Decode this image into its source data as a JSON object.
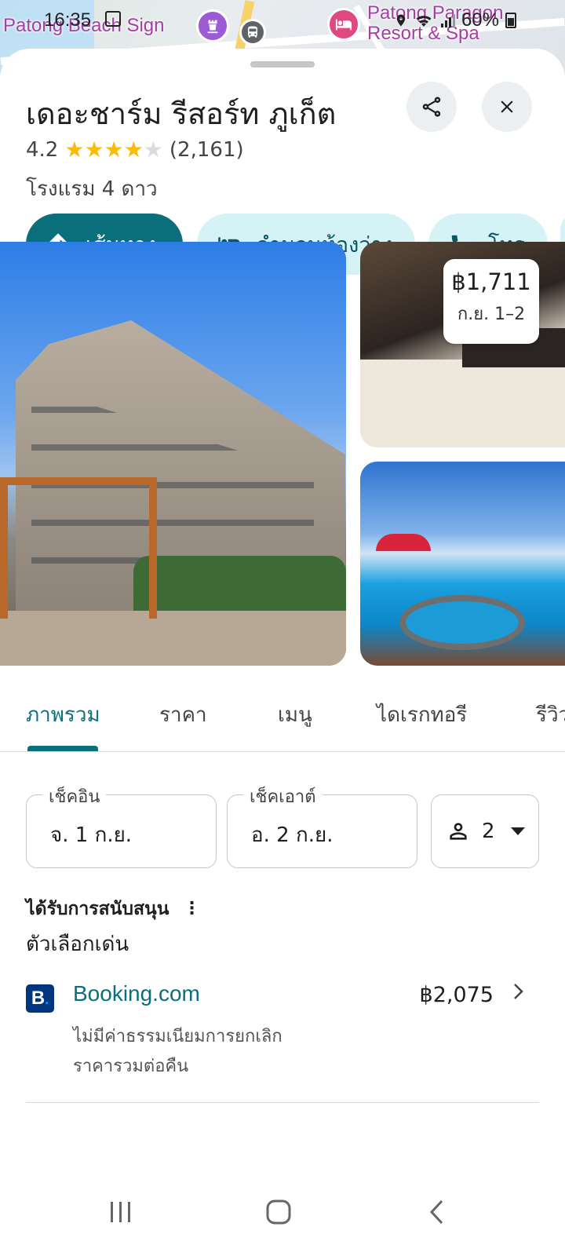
{
  "status_bar": {
    "time": "16:35",
    "battery": "60%"
  },
  "map": {
    "labels": [
      "Patong Beach Sign",
      "Patong Paragon Resort & Spa"
    ]
  },
  "place": {
    "title": "เดอะชาร์ม รีสอร์ท ภูเก็ต",
    "rating": "4.2",
    "rating_stars": 4.2,
    "reviews": "(2,161)",
    "category": "โรงแรม 4 ดาว"
  },
  "actions": {
    "directions": "เส้นทาง",
    "rooms": "จำนวนห้องว่าง",
    "call": "โทร"
  },
  "photo_price": {
    "price": "฿1,711",
    "dates": "ก.ย. 1–2"
  },
  "tabs": [
    "ภาพรวม",
    "ราคา",
    "เมนู",
    "ไดเรกทอรี",
    "รีวิว"
  ],
  "booking": {
    "checkin_label": "เช็คอิน",
    "checkin_value": "จ. 1 ก.ย.",
    "checkout_label": "เช็คเอาต์",
    "checkout_value": "อ. 2 ก.ย.",
    "guests": "2"
  },
  "sponsored_label": "ได้รับการสนับสนุน",
  "featured_label": "ตัวเลือกเด่น",
  "offer": {
    "logo": "B",
    "name": "Booking.com",
    "price": "฿2,075",
    "note1": "ไม่มีค่าธรรมเนียมการยกเลิก",
    "note2": "ราคารวมต่อคืน"
  },
  "colors": {
    "accent": "#0b6f7b",
    "chip_bg": "#d5f2f7",
    "star": "#fbbc04",
    "booking_blue": "#003580"
  }
}
